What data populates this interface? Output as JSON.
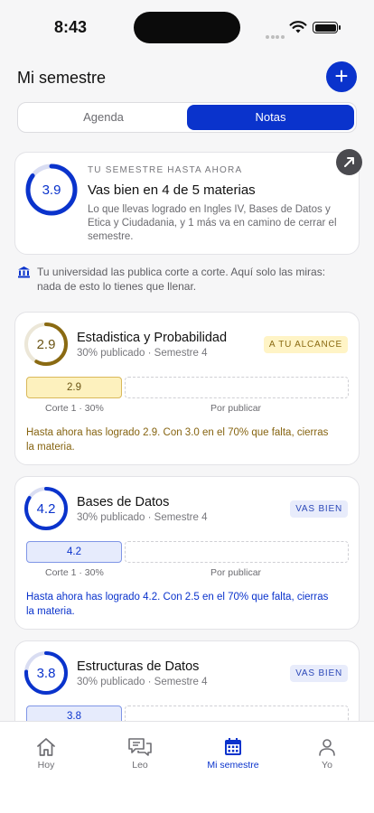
{
  "status": {
    "time": "8:43"
  },
  "header": {
    "title": "Mi semestre",
    "add_label": "+"
  },
  "tabs": [
    {
      "label": "Agenda",
      "active": false
    },
    {
      "label": "Notas",
      "active": true
    }
  ],
  "summary": {
    "grade": "3.9",
    "progress": 0.85,
    "kicker": "TU SEMESTRE HASTA AHORA",
    "title": "Vas bien en 4 de 5 materias",
    "body": "Lo que llevas logrado en Ingles IV, Bases de Datos y Etica y Ciudadania, y 1 más va en camino de cerrar el semestre."
  },
  "info_note": "Tu universidad las publica corte a corte. Aquí solo las miras: nada de esto lo tienes que llenar.",
  "courses": [
    {
      "grade": "2.9",
      "progress": 0.58,
      "ring_color": "#8a6a12",
      "value_color": "#6b5414",
      "name": "Estadistica y Probabilidad",
      "sub": "30% publicado · Semestre 4",
      "badge": "A TU ALCANCE",
      "badge_bg": "#fff4c6",
      "badge_color": "#8a6a12",
      "bar_value": "2.9",
      "bar_bg": "#fdf1be",
      "bar_border": "#d9b85a",
      "bar_color": "#6b5414",
      "bar_label": "Corte 1 · 30%",
      "pending_label": "Por publicar",
      "message": "Hasta ahora has logrado 2.9. Con 3.0 en el 70% que falta, cierras la materia.",
      "message_color": "#866411"
    },
    {
      "grade": "4.2",
      "progress": 0.84,
      "ring_color": "#0a33cc",
      "value_color": "#0a33cc",
      "name": "Bases de Datos",
      "sub": "30% publicado · Semestre 4",
      "badge": "VAS BIEN",
      "badge_bg": "#e8ecfb",
      "badge_color": "#2a47b8",
      "bar_value": "4.2",
      "bar_bg": "#e6ebfc",
      "bar_border": "#7f95e6",
      "bar_color": "#0a33cc",
      "bar_label": "Corte 1 · 30%",
      "pending_label": "Por publicar",
      "message": "Hasta ahora has logrado 4.2. Con 2.5 en el 70% que falta, cierras la materia.",
      "message_color": "#0a33cc"
    },
    {
      "grade": "3.8",
      "progress": 0.76,
      "ring_color": "#0a33cc",
      "value_color": "#0a33cc",
      "name": "Estructuras de Datos",
      "sub": "30% publicado · Semestre 4",
      "badge": "VAS BIEN",
      "badge_bg": "#e8ecfb",
      "badge_color": "#2a47b8",
      "bar_value": "3.8",
      "bar_bg": "#e6ebfc",
      "bar_border": "#7f95e6",
      "bar_color": "#0a33cc"
    }
  ],
  "nav": [
    {
      "label": "Hoy",
      "icon": "home-icon",
      "active": false
    },
    {
      "label": "Leo",
      "icon": "chat-icon",
      "active": false
    },
    {
      "label": "Mi semestre",
      "icon": "calendar-icon",
      "active": true
    },
    {
      "label": "Yo",
      "icon": "person-icon",
      "active": false
    }
  ],
  "colors": {
    "accent": "#0a33cc"
  }
}
